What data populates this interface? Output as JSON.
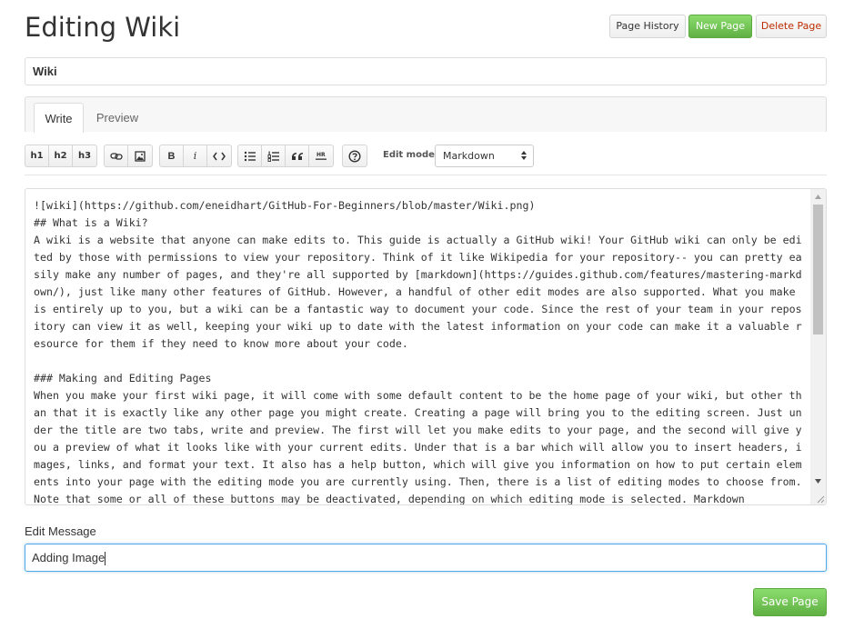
{
  "header": {
    "title": "Editing Wiki",
    "buttons": {
      "history": "Page History",
      "new": "New Page",
      "delete": "Delete Page"
    }
  },
  "page_title_field": {
    "value": "Wiki"
  },
  "tabs": {
    "write": "Write",
    "preview": "Preview"
  },
  "toolbar": {
    "h1": "h1",
    "h2": "h2",
    "h3": "h3",
    "bold": "B",
    "italic": "i",
    "hr": "HR",
    "icons": [
      "h1",
      "h2",
      "h3",
      "link-icon",
      "image-icon",
      "bold-icon",
      "italic-icon",
      "code-icon",
      "bullet-list-icon",
      "numbered-list-icon",
      "blockquote-icon",
      "horizontal-rule-icon",
      "help-icon"
    ],
    "edit_mode_label": "Edit mode:",
    "edit_mode_value": "Markdown"
  },
  "editor": {
    "content": "![wiki](https://github.com/eneidhart/GitHub-For-Beginners/blob/master/Wiki.png)\n## What is a Wiki?\nA wiki is a website that anyone can make edits to. This guide is actually a GitHub wiki! Your GitHub wiki can only be edited by those with permissions to view your repository. Think of it like Wikipedia for your repository-- you can pretty easily make any number of pages, and they're all supported by [markdown](https://guides.github.com/features/mastering-markdown/), just like many other features of GitHub. However, a handful of other edit modes are also supported. What you make is entirely up to you, but a wiki can be a fantastic way to document your code. Since the rest of your team in your repository can view it as well, keeping your wiki up to date with the latest information on your code can make it a valuable resource for them if they need to know more about your code.\n\n### Making and Editing Pages\nWhen you make your first wiki page, it will come with some default content to be the home page of your wiki, but other than that it is exactly like any other page you might create. Creating a page will bring you to the editing screen. Just under the title are two tabs, write and preview. The first will let you make edits to your page, and the second will give you a preview of what it looks like with your current edits. Under that is a bar which will allow you to insert headers, images, links, and format your text. It also has a help button, which will give you information on how to put certain elements into your page with the editing mode you are currently using. Then, there is a list of editing modes to choose from. Note that some or all of these buttons may be deactivated, depending on which editing mode is selected. Markdown"
  },
  "edit_message": {
    "label": "Edit Message",
    "value": "Adding Image"
  },
  "save_button": "Save Page",
  "colors": {
    "green_button": "#60b044",
    "delete_text": "#bd2c00",
    "focus_border": "#51a7e8"
  }
}
